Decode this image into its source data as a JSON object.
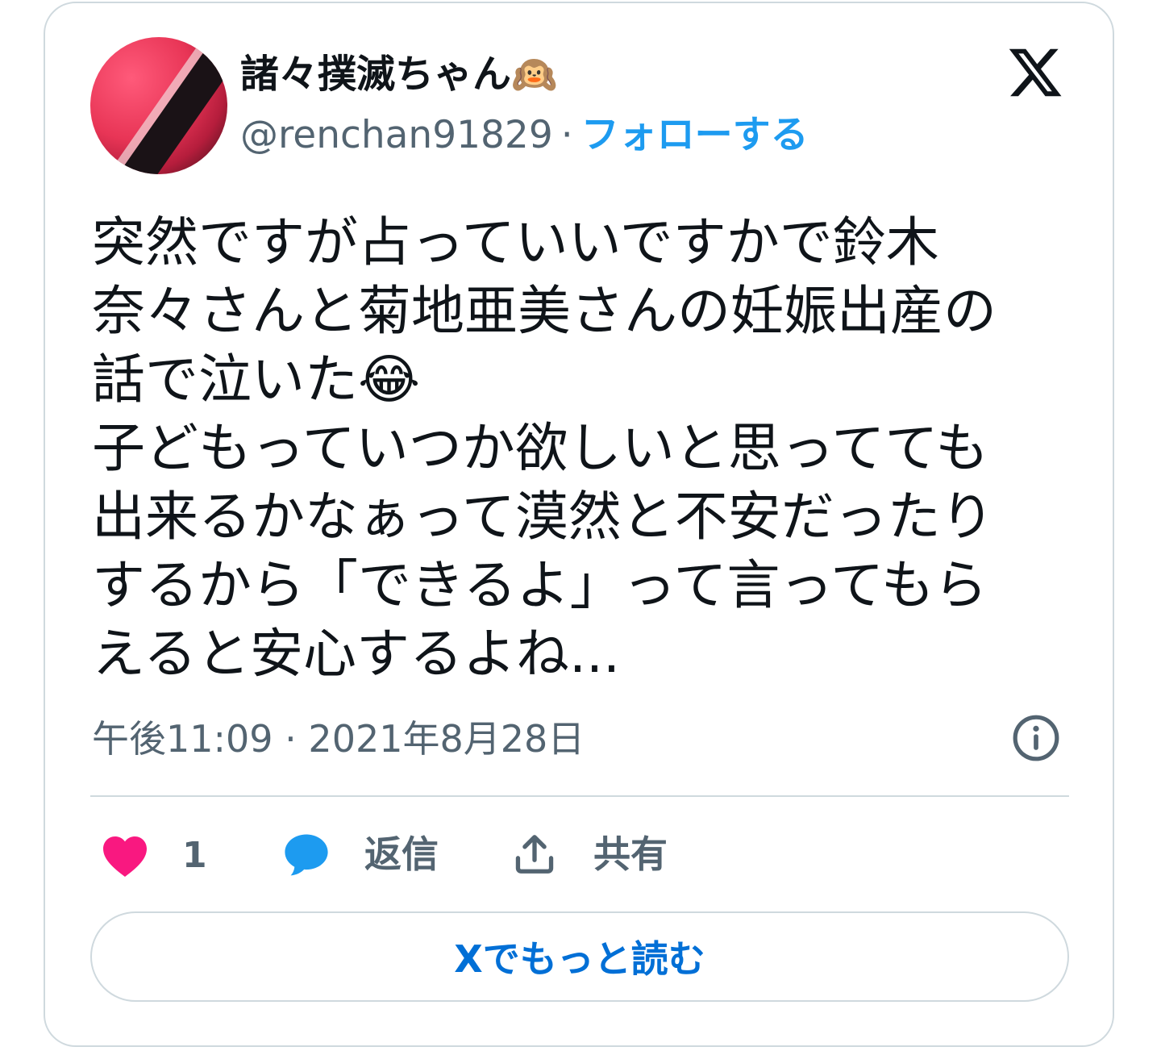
{
  "author": {
    "display_name": "諸々撲滅ちゃん",
    "name_emoji": "🙉",
    "handle": "@renchan91829",
    "separator": "·",
    "follow_label": "フォローする"
  },
  "tweet": {
    "lines": [
      "突然ですが占っていいですかで鈴木",
      "奈々さんと菊地亜美さんの妊娠出産の",
      "話で泣いた",
      "子どもっていつか欲しいと思ってても",
      "出来るかなぁって漠然と不安だったり",
      "するから「できるよ」って言ってもら",
      "えると安心するよね..."
    ],
    "inline_emoji": "😂",
    "timestamp": "午後11:09 · 2021年8月28日"
  },
  "actions": {
    "like_count": "1",
    "reply_label": "返信",
    "share_label": "共有"
  },
  "read_more_label": "Xでもっと読む",
  "colors": {
    "accent": "#1d9bf0",
    "link": "#006fd6",
    "heart": "#f91880",
    "muted": "#536471",
    "border": "#cfd9de"
  },
  "icons": {
    "logo": "x-logo-icon",
    "info": "info-icon",
    "like": "heart-icon",
    "reply": "speech-bubble-icon",
    "share": "share-upload-icon"
  }
}
